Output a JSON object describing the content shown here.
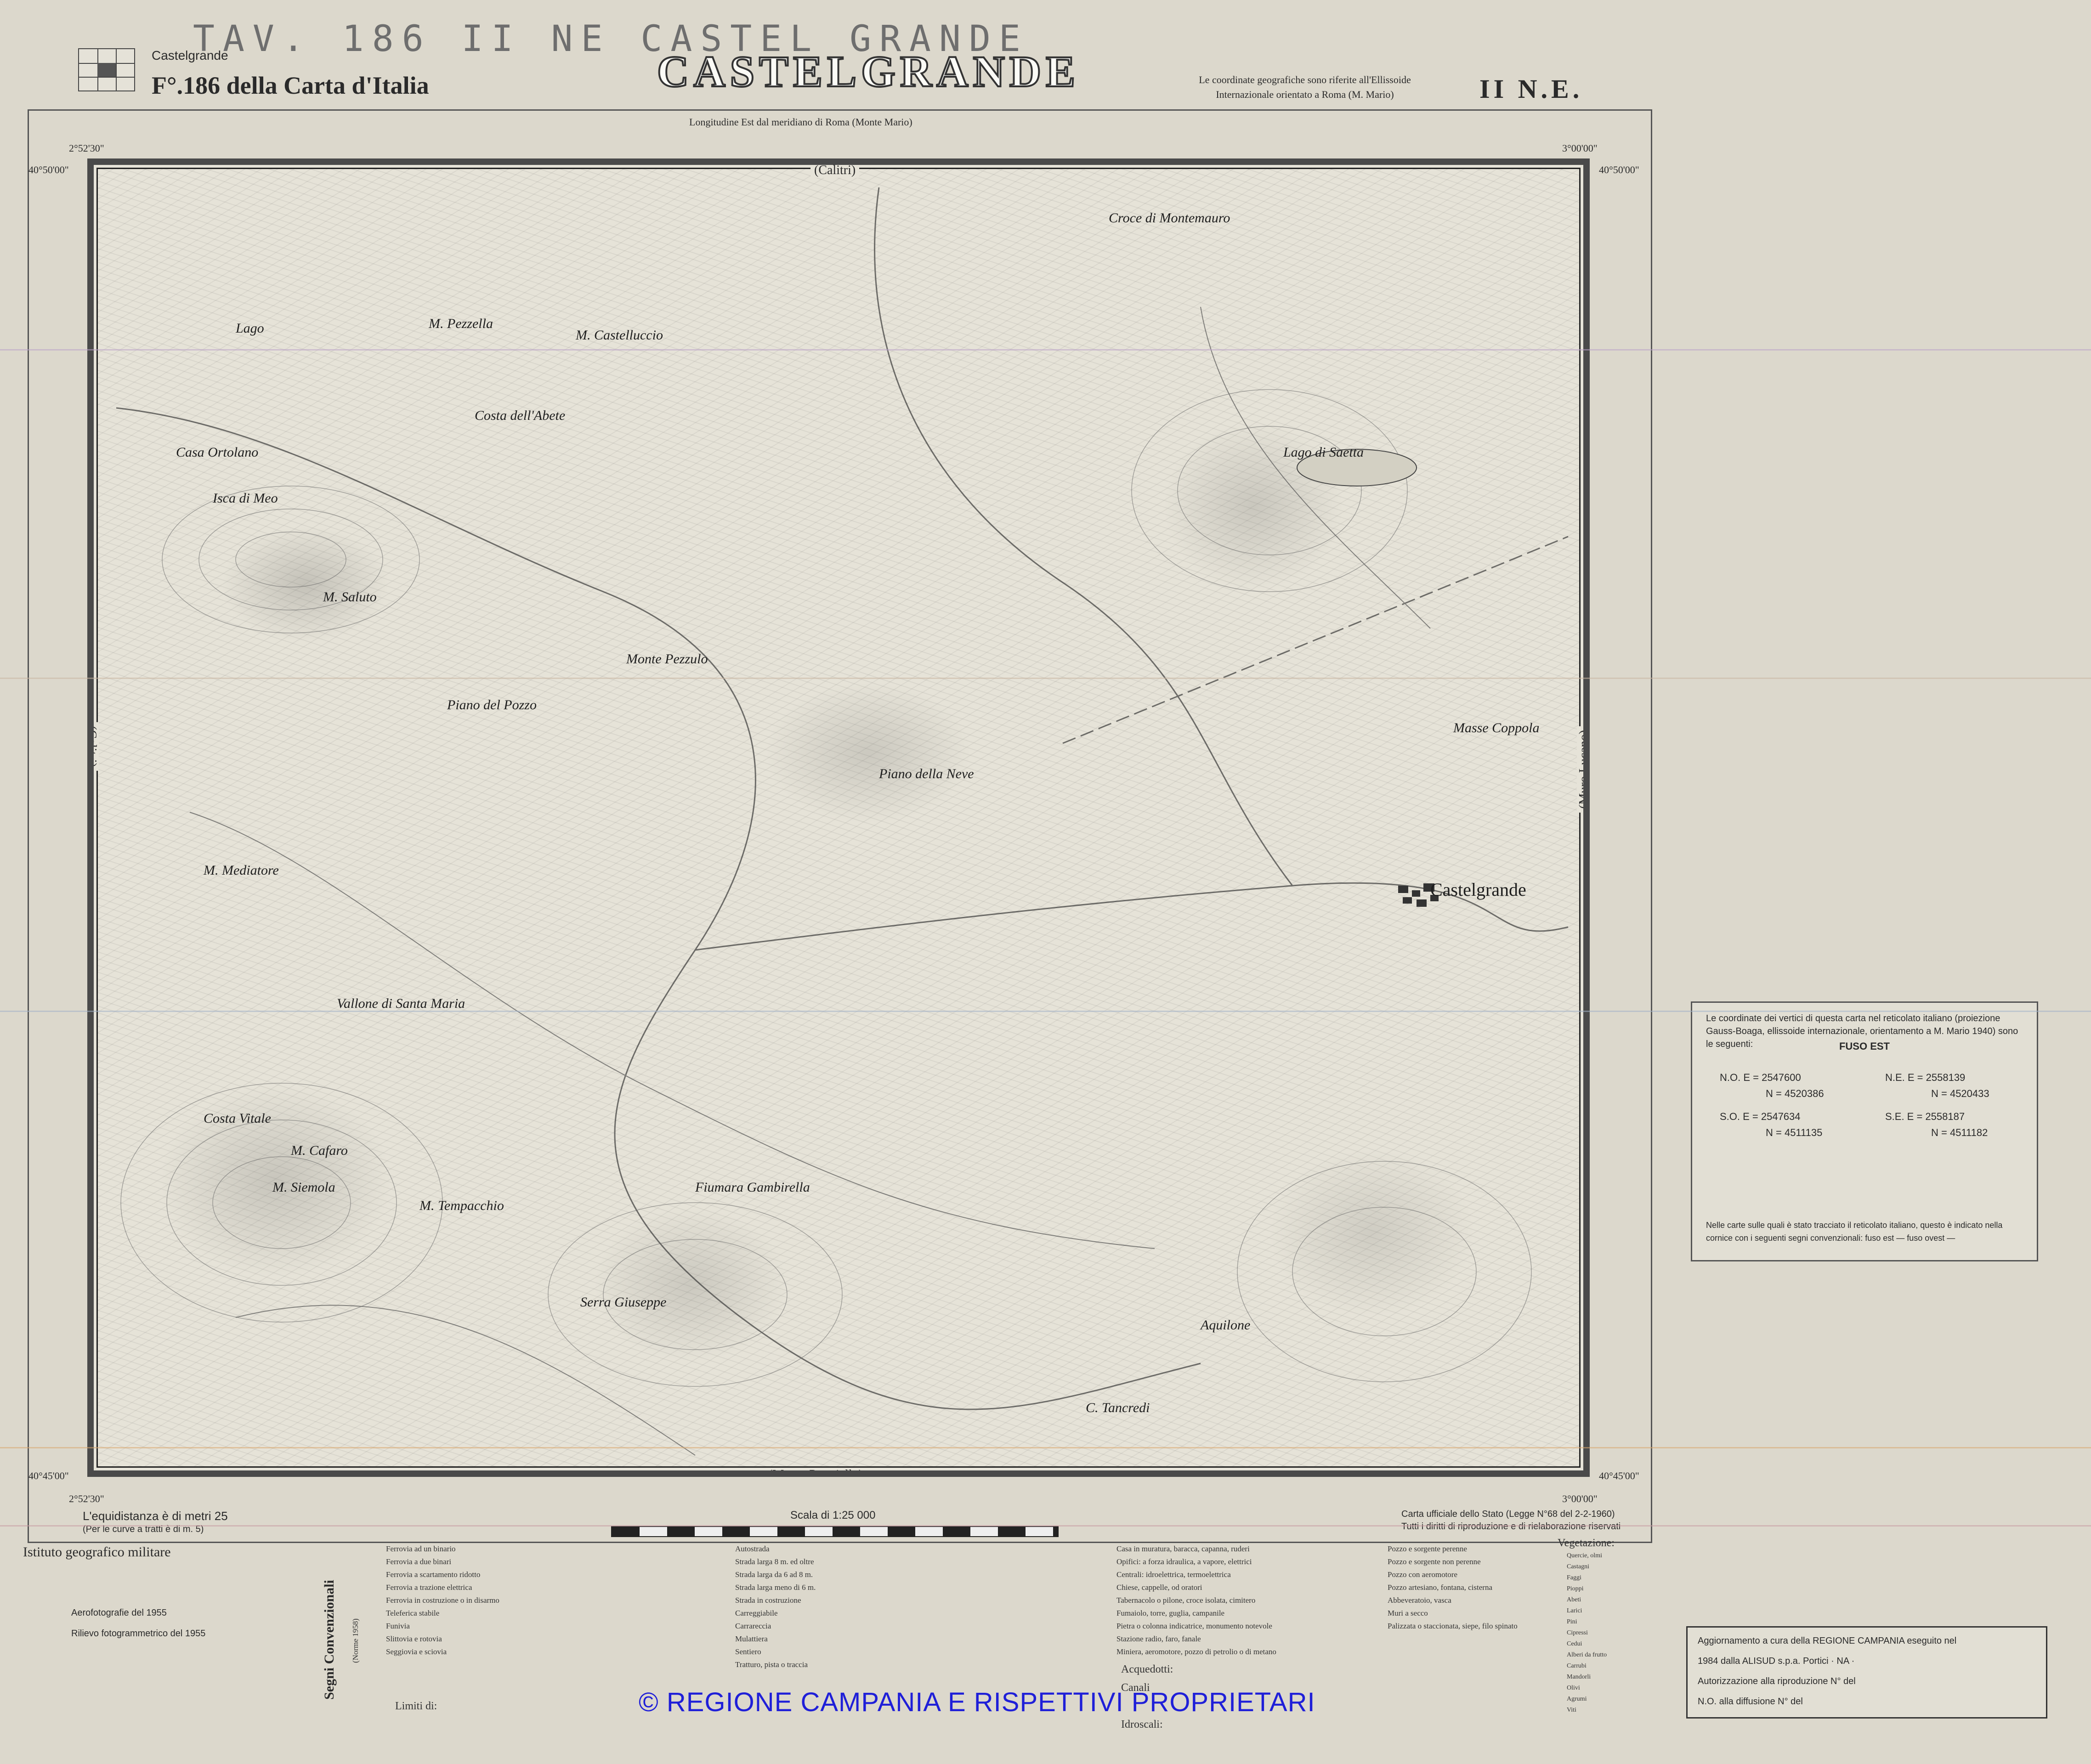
{
  "header": {
    "handwritten": "TAV. 186 II NE CASTEL GRANDE",
    "title": "CASTELGRANDE",
    "sheet_name": "Castelgrande",
    "foglio": "F°.186 della Carta d'Italia",
    "ellipsoid_line1": "Le coordinate geografiche sono riferite all'Ellissoide",
    "ellipsoid_line2": "Internazionale orientato a Roma (M. Mario)",
    "quadrant": "II N.E."
  },
  "frame": {
    "meridian_label": "Longitudine Est dal meridiano di Roma (Monte Mario)",
    "corner_tl_lon": "2°52'30\"",
    "corner_tr_lon": "3°00'00\"",
    "corner_tl_lat": "40°50'00\"",
    "corner_tr_lat": "40°50'00\"",
    "corner_bl_lat": "40°45'00\"",
    "corner_br_lat": "40°45'00\"",
    "corner_bl_lon": "2°52'30\"",
    "corner_br_lon": "3°00'00\"",
    "edge_top": "(Calitri)",
    "edge_bottom": "(Monte Paratiello)",
    "edge_left": "(Calitri)",
    "edge_right": "(Muro Lucano)"
  },
  "places": [
    "Castelgrande",
    "Lago di Saetta",
    "M. Cafaro",
    "M. Siemola",
    "M. Pezzella",
    "M. Castelluccio",
    "M. Mediatore",
    "M. Saluto",
    "Casa Ortolano",
    "Isca di Meo",
    "Lago",
    "Costa dell'Abete",
    "Piano del Pozzo",
    "Monte Pezzulo",
    "Vallone di Santa Maria",
    "M. Tempacchio",
    "Serra Giuseppe",
    "Fiumara Gambirella",
    "Piano della Neve",
    "Costa Vitale",
    "Aquilone",
    "C. Tancredi",
    "Masse Coppola",
    "Croce di Montemauro"
  ],
  "grid_table": {
    "intro": "Le coordinate dei vertici di questa carta nel reticolato italiano (proiezione Gauss-Boaga, ellissoide internazionale, orientamento a M. Mario 1940) sono le seguenti:",
    "fuso": "FUSO EST",
    "no_e": "N.O. E = 2547600",
    "no_n": "N = 4520386",
    "ne_e": "N.E. E = 2558139",
    "ne_n": "N = 4520433",
    "so_e": "S.O. E = 2547634",
    "so_n": "N = 4511135",
    "se_e": "S.E. E = 2558187",
    "se_n": "N = 4511182",
    "note": "Nelle carte sulle quali è stato tracciato il reticolato italiano, questo è indicato nella cornice con i seguenti segni convenzionali: fuso est — fuso ovest —"
  },
  "bottom": {
    "equidistanza": "L'equidistanza è di metri 25",
    "curve_note": "(Per le curve a tratti è di m. 5)",
    "scale": "Scala di 1:25 000",
    "carta_ufficiale": "Carta ufficiale dello Stato (Legge N°68 del 2-2-1960)",
    "diritti": "Tutti i diritti di riproduzione e di rielaborazione riservati",
    "istituto": "Istituto geografico militare",
    "aerofoto": "Aerofotografie del 1955",
    "rilievo": "Rilievo fotogrammetrico del 1955",
    "segni": "Segni Convenzionali",
    "norme": "(Norme 1958)",
    "vegetazione": "Vegetazione:",
    "limiti": "Limiti di:",
    "acquedotti": "Acquedotti:",
    "canali": "Canali",
    "idroscali": "Idroscali:"
  },
  "legend": {
    "rail": [
      "Ferrovia ad un binario",
      "Ferrovia a due binari",
      "Ferrovia a scartamento ridotto",
      "Ferrovia a trazione elettrica",
      "Ferrovia in costruzione o in disarmo",
      "Teleferica stabile",
      "Funivia",
      "Slittovia e rotovia",
      "Seggiovia e sciovia"
    ],
    "roads": [
      "Autostrada",
      "Strada larga 8 m. ed oltre",
      "Strada larga da 6 ad 8 m.",
      "Strada larga meno di 6 m.",
      "Strada in costruzione",
      "Carreggiabile",
      "Carrareccia",
      "Mulattiera",
      "Sentiero",
      "Tratturo, pista o traccia"
    ],
    "buildings": [
      "Casa in muratura, baracca, capanna, ruderi",
      "Opifici: a forza idraulica, a vapore, elettrici",
      "Centrali: idroelettrica, termoelettrica",
      "Chiese, cappelle, od oratori",
      "Tabernacolo o pilone, croce isolata, cimitero",
      "Fumaiolo, torre, guglia, campanile",
      "Pietra o colonna indicatrice, monumento notevole",
      "Stazione radio, faro, fanale",
      "Miniera, aeromotore, pozzo di petrolio o di metano"
    ],
    "wells": [
      "Pozzo e sorgente perenne",
      "Pozzo e sorgente non perenne",
      "Pozzo con aeromotore",
      "Pozzo artesiano, fontana, cisterna",
      "Abbeveratoio, vasca",
      "Muri a secco",
      "Palizzata o staccionata, siepe, filo spinato"
    ],
    "vegetation": [
      "Quercie, olmi",
      "Castagni",
      "Faggi",
      "Pioppi",
      "Abeti",
      "Larici",
      "Pini",
      "Cipressi",
      "Cedui",
      "Alberi da frutto",
      "Carrubi",
      "Mandorli",
      "Olivi",
      "Agrumi",
      "Viti"
    ]
  },
  "update_box": {
    "line1": "Aggiornamento a cura della REGIONE CAMPANIA eseguito nel",
    "line2": "1984 dalla ALISUD s.p.a. Portici · NA ·",
    "line3": "Autorizzazione alla riproduzione N°          del",
    "line4": "N.O. alla diffusione N°          del"
  },
  "watermark": "© REGIONE CAMPANIA E RISPETTIVI PROPRIETARI",
  "colors": {
    "paper": "#dcd8cc",
    "map": "#e6e3d8",
    "ink": "#2a2a2a",
    "watermark": "#1f1fd8"
  }
}
